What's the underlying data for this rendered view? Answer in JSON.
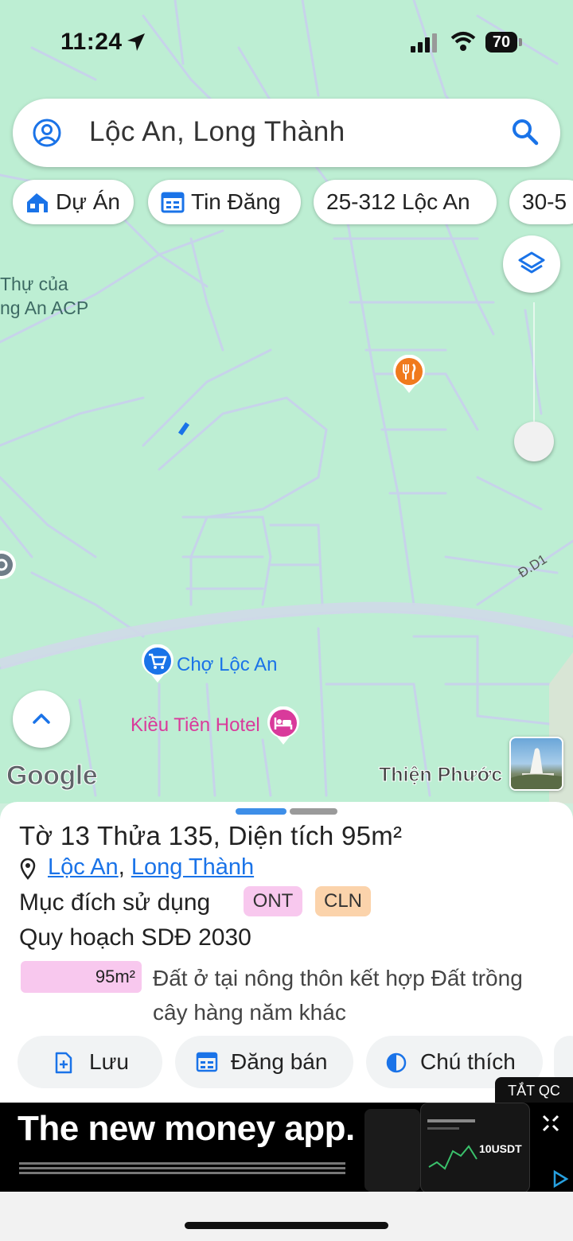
{
  "status_bar": {
    "time": "11:24",
    "battery": "70"
  },
  "search": {
    "query": "Lộc An, Long Thành"
  },
  "chips": [
    {
      "label": "Dự Án",
      "icon": "house-icon"
    },
    {
      "label": "Tin Đăng",
      "icon": "calendar-icon"
    },
    {
      "label": "25-312 Lộc An"
    },
    {
      "label": "30-5"
    }
  ],
  "map": {
    "label_partial_line1": "Thự của",
    "label_partial_line2": "ng An ACP",
    "road_label": "Đ.D1",
    "poi_market": "Chợ Lộc An",
    "poi_hotel": "Kiều Tiên Hotel",
    "google_logo": "Google",
    "place_label": "Thiện Phước"
  },
  "sheet": {
    "title": "Tờ 13 Thửa 135, Diện tích 95m²",
    "location_part1": "Lộc An",
    "location_sep": ", ",
    "location_part2": "Long Thành",
    "purpose_label": "Mục đích sử dụng",
    "tags": [
      "ONT",
      "CLN"
    ],
    "tag_colors": {
      "ONT": "#f8c8ee",
      "CLN": "#fbd3ab"
    },
    "plan_label": "Quy hoạch SDĐ 2030",
    "area_value": "95m²",
    "land_description": "Đất ở tại nông thôn kết hợp Đất trồng cây hàng năm khác",
    "actions": [
      {
        "label": "Lưu",
        "icon": "add-file-icon"
      },
      {
        "label": "Đăng bán",
        "icon": "calendar-icon"
      },
      {
        "label": "Chú thích",
        "icon": "contrast-icon"
      }
    ]
  },
  "ad": {
    "close_label": "TẮT QC",
    "headline": "The new money app.",
    "phone_text": "10USDT"
  },
  "colors": {
    "accent": "#1a73e8",
    "map_bg": "#bdeed3",
    "road": "#c9d6ea",
    "poi_food": "#f07a1d",
    "poi_hotel": "#d93a9b"
  }
}
